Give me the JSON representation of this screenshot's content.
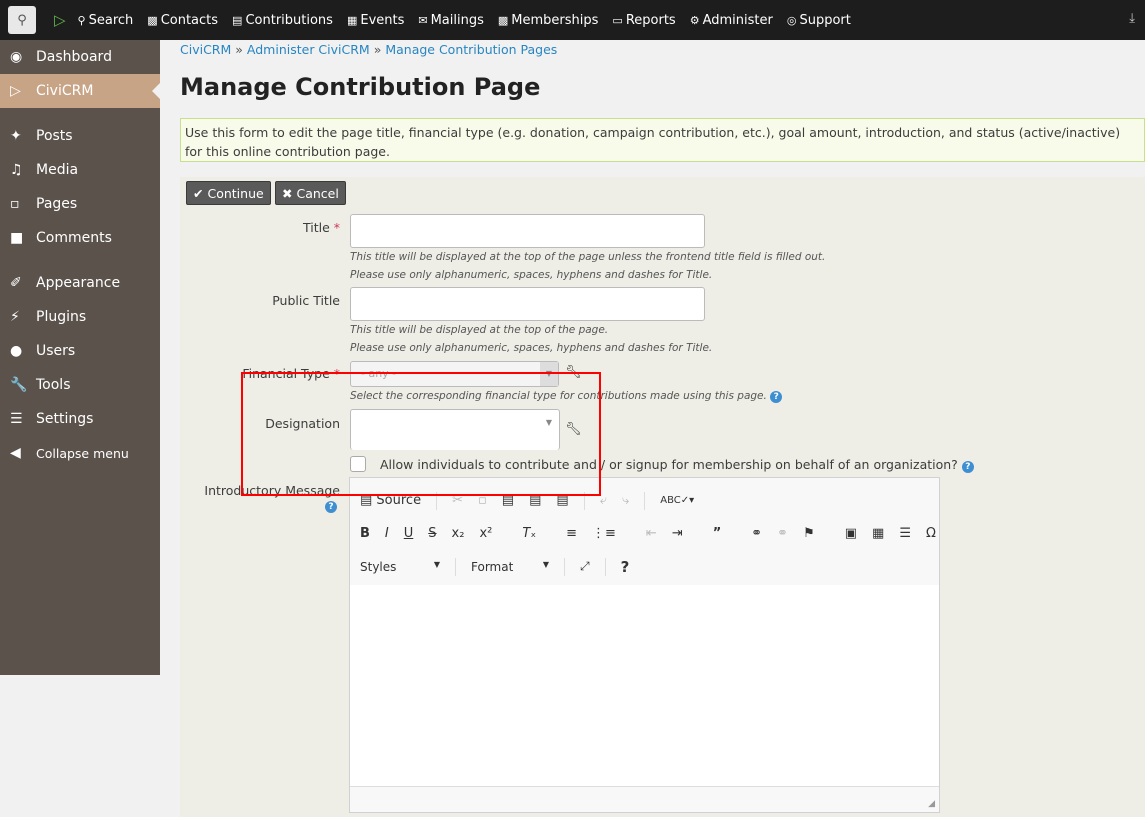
{
  "topbar": {
    "items": [
      {
        "icon": "search-icon",
        "label": "Search"
      },
      {
        "icon": "contacts-icon",
        "label": "Contacts"
      },
      {
        "icon": "credit-card-icon",
        "label": "Contributions"
      },
      {
        "icon": "calendar-icon",
        "label": "Events"
      },
      {
        "icon": "envelope-icon",
        "label": "Mailings"
      },
      {
        "icon": "id-badge-icon",
        "label": "Memberships"
      },
      {
        "icon": "bar-chart-icon",
        "label": "Reports"
      },
      {
        "icon": "gears-icon",
        "label": "Administer"
      },
      {
        "icon": "life-ring-icon",
        "label": "Support"
      }
    ]
  },
  "sidebar": {
    "items": [
      {
        "label": "Dashboard"
      },
      {
        "label": "CiviCRM"
      },
      {
        "label": "Posts"
      },
      {
        "label": "Media"
      },
      {
        "label": "Pages"
      },
      {
        "label": "Comments"
      },
      {
        "label": "Appearance"
      },
      {
        "label": "Plugins"
      },
      {
        "label": "Users"
      },
      {
        "label": "Tools"
      },
      {
        "label": "Settings"
      },
      {
        "label": "Collapse menu"
      }
    ]
  },
  "breadcrumb": [
    "CiviCRM",
    "Administer CiviCRM",
    "Manage Contribution Pages"
  ],
  "page_title": "Manage Contribution Page",
  "help_text": "Use this form to edit the page title, financial type (e.g. donation, campaign contribution, etc.), goal amount, introduction, and status (active/inactive) for this online contribution page.",
  "buttons": {
    "continue": "Continue",
    "cancel": "Cancel"
  },
  "form": {
    "title_label": "Title",
    "title_value": "",
    "title_desc1": "This title will be displayed at the top of the page unless the frontend title field is filled out.",
    "title_desc2": "Please use only alphanumeric, spaces, hyphens and dashes for Title.",
    "public_title_label": "Public Title",
    "public_title_value": "",
    "public_title_desc1": "This title will be displayed at the top of the page.",
    "public_title_desc2": "Please use only alphanumeric, spaces, hyphens and dashes for Title.",
    "financial_type_label": "Financial Type",
    "financial_type_value": "- any -",
    "financial_type_desc": "Select the corresponding financial type for contributions made using this page.",
    "designation_label": "Designation",
    "on_behalf_label": "Allow individuals to contribute and / or signup for membership on behalf of an organization?",
    "on_behalf_checked": false,
    "intro_label": "Introductory Message"
  },
  "editor": {
    "source": "Source",
    "styles": "Styles",
    "format": "Format"
  }
}
